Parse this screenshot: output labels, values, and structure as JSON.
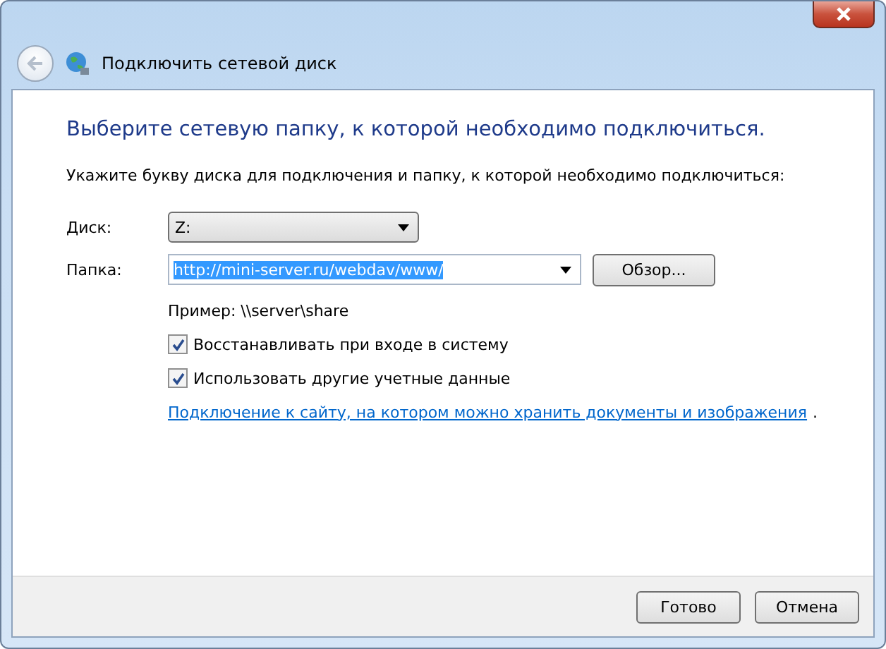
{
  "window": {
    "title": "Подключить сетевой диск"
  },
  "heading": "Выберите сетевую папку, к которой необходимо подключиться.",
  "instruction": "Укажите букву диска для подключения и папку, к которой необходимо подключиться:",
  "drive": {
    "label": "Диск:",
    "value": "Z:"
  },
  "folder": {
    "label": "Папка:",
    "value": "http://mini-server.ru/webdav/www/",
    "browse": "Обзор..."
  },
  "example": "Пример: \\\\server\\share",
  "options": [
    {
      "label": "Восстанавливать при входе в систему",
      "checked": true
    },
    {
      "label": "Использовать другие учетные данные",
      "checked": true
    }
  ],
  "link": "Подключение к сайту, на котором можно хранить документы и изображения",
  "link_suffix": ".",
  "buttons": [
    "Готово",
    "Отмена"
  ]
}
